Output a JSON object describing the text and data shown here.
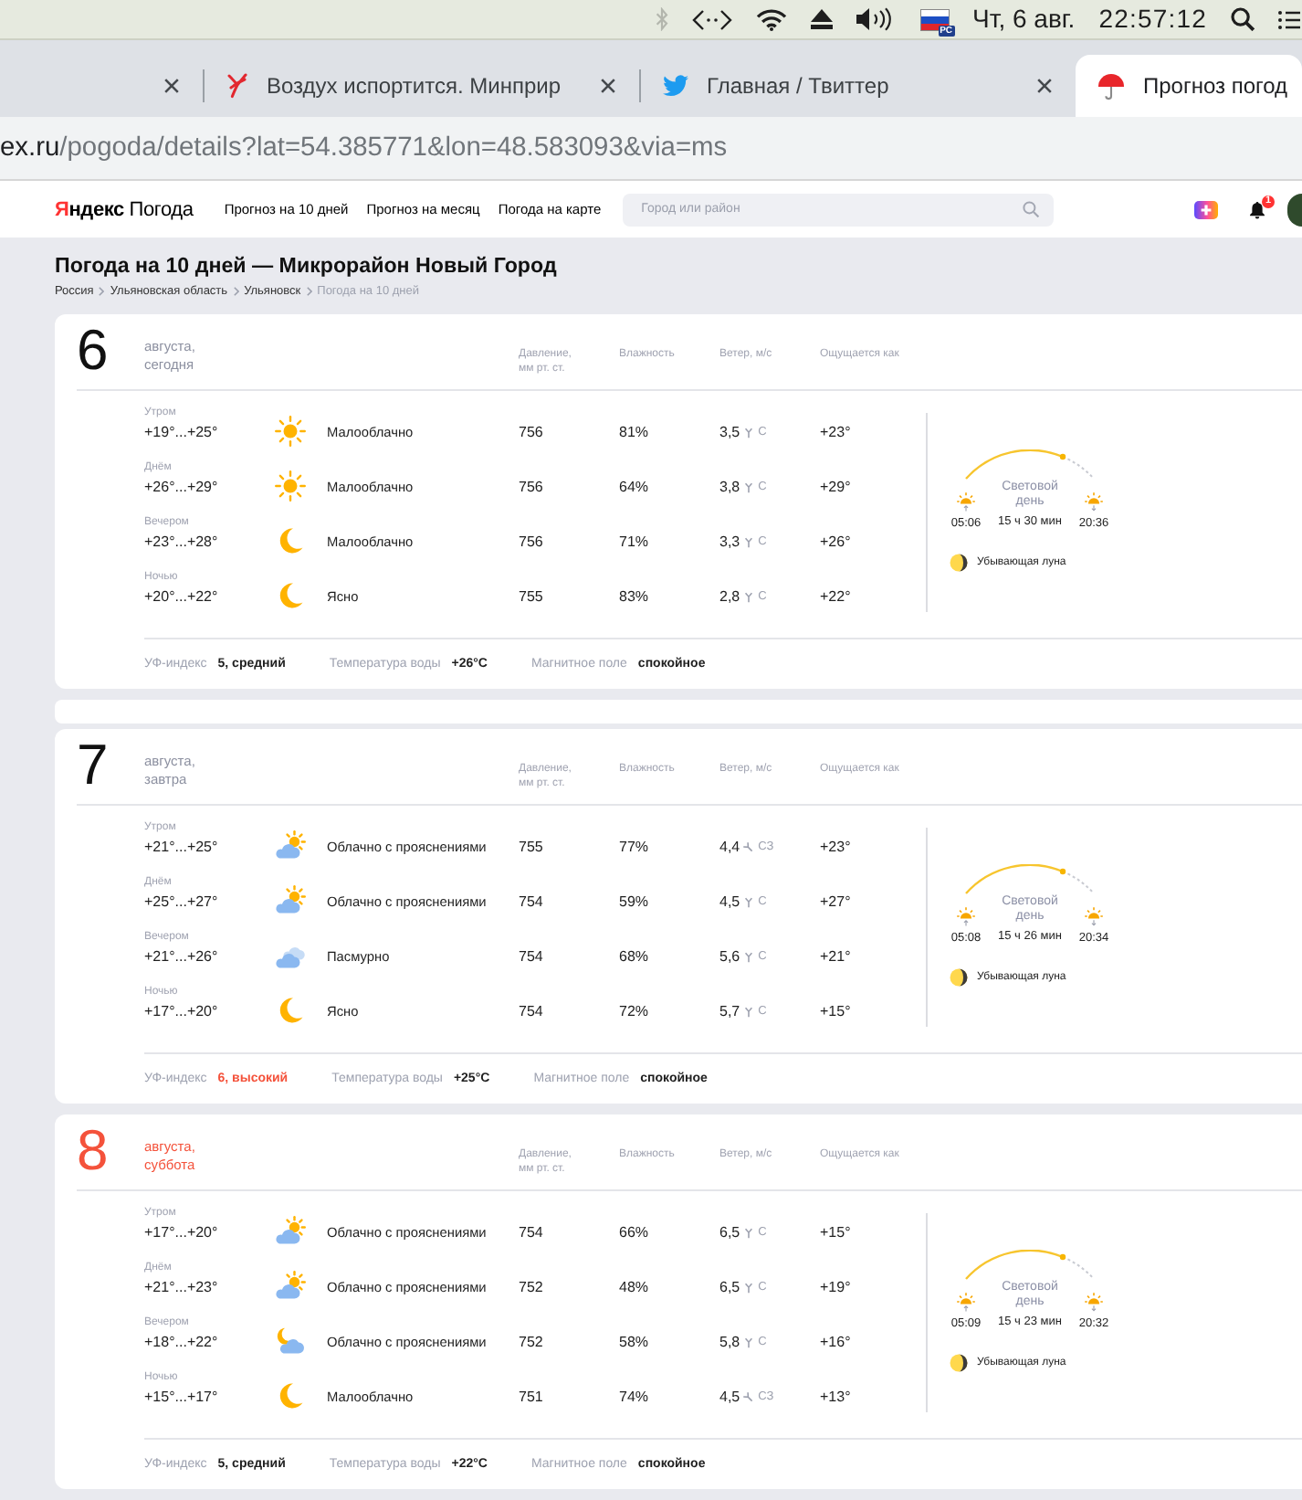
{
  "menu_bar": {
    "bluetooth_disabled": true,
    "keyboard_layout": "PC",
    "date": "Чт, 6 авг.",
    "time": "22:57:12"
  },
  "tabs": [
    {
      "kind": "blank",
      "closable": true,
      "selected": false
    },
    {
      "kind": "scribble",
      "title": "Воздух испортится. Минприр",
      "closable": true,
      "selected": false
    },
    {
      "kind": "bird",
      "title": "Главная / Твиттер",
      "closable": true,
      "selected": false
    },
    {
      "kind": "umbrella",
      "title": "Прогноз погод",
      "closable": false,
      "selected": true
    }
  ],
  "address_bar": {
    "host": "ex.ru",
    "path": "/pogoda/details?lat=54.385771&lon=48.583093&via=ms"
  },
  "site_header": {
    "logo": "**Яндекс** Погода",
    "nav": [
      "Прогноз на 10 дней",
      "Прогноз на месяц",
      "Погода на карте"
    ],
    "search": {
      "placeholder": "Город или район"
    },
    "notifications": "1"
  },
  "page": {
    "title": "Погода на 10 дней — Микрорайон Новый Город",
    "breadcrumbs": [
      {
        "label": "Россия",
        "current": false
      },
      {
        "label": "Ульяновская область",
        "current": false
      },
      {
        "label": "Ульяновск",
        "current": false
      },
      {
        "label": "Погода на 10 дней",
        "current": true
      }
    ]
  },
  "days": [
    {
      "day": "6",
      "caption": "августа, сегодня",
      "weekend": false,
      "columns": [
        "Давление,\nмм рт. ст.",
        "Влажность",
        "Ветер, м/с",
        "Ощущается как"
      ],
      "parts": [
        {
          "part": "Утром",
          "temp": "+19°...+25°",
          "kind": "sun",
          "condition": "Малооблачно",
          "pressure": "756",
          "humidity": "81%",
          "wind_speed": "3,5",
          "arrow_tilted": false,
          "wind_dir": "С",
          "feels": "+23°"
        },
        {
          "part": "Днём",
          "temp": "+26°...+29°",
          "kind": "sun",
          "condition": "Малооблачно",
          "pressure": "756",
          "humidity": "64%",
          "wind_speed": "3,8",
          "arrow_tilted": false,
          "wind_dir": "С",
          "feels": "+29°"
        },
        {
          "part": "Вечером",
          "temp": "+23°...+28°",
          "kind": "moon",
          "condition": "Малооблачно",
          "pressure": "756",
          "humidity": "71%",
          "wind_speed": "3,3",
          "arrow_tilted": false,
          "wind_dir": "С",
          "feels": "+26°"
        },
        {
          "part": "Ночью",
          "temp": "+20°...+22°",
          "kind": "moon",
          "condition": "Ясно",
          "pressure": "755",
          "humidity": "83%",
          "wind_speed": "2,8",
          "arrow_tilted": false,
          "wind_dir": "С",
          "feels": "+22°"
        }
      ],
      "sun": {
        "sunrise": "05:06",
        "label": "Световой день",
        "duration": "15 ч 30 мин",
        "sunset": "20:36"
      },
      "moon": "Убывающая луна",
      "footer": {
        "uv_label": "УФ-индекс",
        "uv": "5, средний",
        "uv_high": false,
        "water_label": "Температура воды",
        "water": "+26°C",
        "magnet_label": "Магнитное поле",
        "magnet": "спокойное"
      },
      "blank_banner_after": true
    },
    {
      "day": "7",
      "caption": "августа, завтра",
      "weekend": false,
      "columns": [
        "Давление,\nмм рт. ст.",
        "Влажность",
        "Ветер, м/с",
        "Ощущается как"
      ],
      "parts": [
        {
          "part": "Утром",
          "temp": "+21°...+25°",
          "kind": "cloud-sun",
          "condition": "Облачно с прояснениями",
          "pressure": "755",
          "humidity": "77%",
          "wind_speed": "4,4",
          "arrow_tilted": true,
          "wind_dir": "СЗ",
          "feels": "+23°"
        },
        {
          "part": "Днём",
          "temp": "+25°...+27°",
          "kind": "cloud-sun",
          "condition": "Облачно с прояснениями",
          "pressure": "754",
          "humidity": "59%",
          "wind_speed": "4,5",
          "arrow_tilted": false,
          "wind_dir": "С",
          "feels": "+27°"
        },
        {
          "part": "Вечером",
          "temp": "+21°...+26°",
          "kind": "cloud",
          "condition": "Пасмурно",
          "pressure": "754",
          "humidity": "68%",
          "wind_speed": "5,6",
          "arrow_tilted": false,
          "wind_dir": "С",
          "feels": "+21°"
        },
        {
          "part": "Ночью",
          "temp": "+17°...+20°",
          "kind": "moon",
          "condition": "Ясно",
          "pressure": "754",
          "humidity": "72%",
          "wind_speed": "5,7",
          "arrow_tilted": false,
          "wind_dir": "С",
          "feels": "+15°"
        }
      ],
      "sun": {
        "sunrise": "05:08",
        "label": "Световой день",
        "duration": "15 ч 26 мин",
        "sunset": "20:34"
      },
      "moon": "Убывающая луна",
      "footer": {
        "uv_label": "УФ-индекс",
        "uv": "6, высокий",
        "uv_high": true,
        "water_label": "Температура воды",
        "water": "+25°C",
        "magnet_label": "Магнитное поле",
        "magnet": "спокойное"
      },
      "blank_banner_after": false
    },
    {
      "day": "8",
      "caption": "августа, суббота",
      "weekend": true,
      "columns": [
        "Давление,\nмм рт. ст.",
        "Влажность",
        "Ветер, м/с",
        "Ощущается как"
      ],
      "parts": [
        {
          "part": "Утром",
          "temp": "+17°...+20°",
          "kind": "cloud-sun",
          "condition": "Облачно с прояснениями",
          "pressure": "754",
          "humidity": "66%",
          "wind_speed": "6,5",
          "arrow_tilted": false,
          "wind_dir": "С",
          "feels": "+15°"
        },
        {
          "part": "Днём",
          "temp": "+21°...+23°",
          "kind": "cloud-sun",
          "condition": "Облачно с прояснениями",
          "pressure": "752",
          "humidity": "48%",
          "wind_speed": "6,5",
          "arrow_tilted": false,
          "wind_dir": "С",
          "feels": "+19°"
        },
        {
          "part": "Вечером",
          "temp": "+18°...+22°",
          "kind": "cloud-moon",
          "condition": "Облачно с прояснениями",
          "pressure": "752",
          "humidity": "58%",
          "wind_speed": "5,8",
          "arrow_tilted": false,
          "wind_dir": "С",
          "feels": "+16°"
        },
        {
          "part": "Ночью",
          "temp": "+15°...+17°",
          "kind": "moon",
          "condition": "Малооблачно",
          "pressure": "751",
          "humidity": "74%",
          "wind_speed": "4,5",
          "arrow_tilted": true,
          "wind_dir": "СЗ",
          "feels": "+13°"
        }
      ],
      "sun": {
        "sunrise": "05:09",
        "label": "Световой день",
        "duration": "15 ч 23 мин",
        "sunset": "20:32"
      },
      "moon": "Убывающая луна",
      "footer": {
        "uv_label": "УФ-индекс",
        "uv": "5, средний",
        "uv_high": false,
        "water_label": "Температура воды",
        "water": "+22°C",
        "magnet_label": "Магнитное поле",
        "magnet": "спокойное"
      },
      "blank_banner_after": false
    }
  ]
}
